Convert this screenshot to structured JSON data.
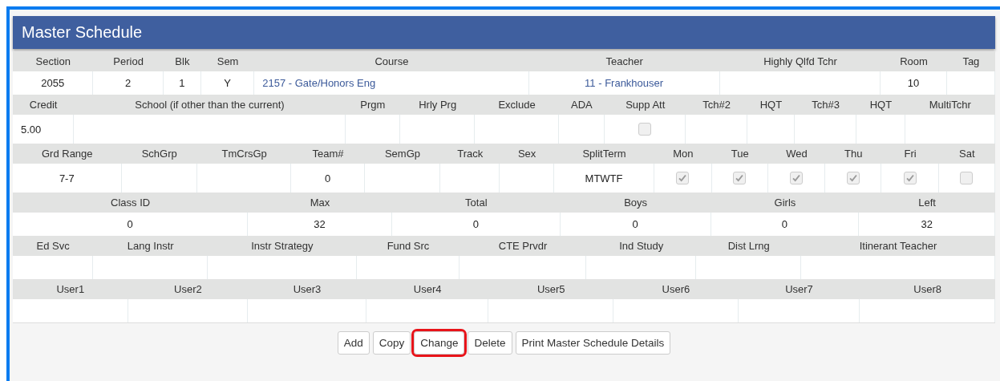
{
  "panel": {
    "title": "Master Schedule"
  },
  "sections": [
    {
      "columns": [
        {
          "label": "Section",
          "kind": "text",
          "value": "2055"
        },
        {
          "label": "Period",
          "kind": "text",
          "value": "2"
        },
        {
          "label": "Blk",
          "kind": "text",
          "value": "1"
        },
        {
          "label": "Sem",
          "kind": "text",
          "value": "Y"
        },
        {
          "label": "Course",
          "kind": "link",
          "value": "2157 - Gate/Honors Eng"
        },
        {
          "label": "Teacher",
          "kind": "link",
          "value": "11 - Frankhouser"
        },
        {
          "label": "Highly Qlfd Tchr",
          "kind": "empty"
        },
        {
          "label": "Room",
          "kind": "text",
          "value": "10"
        },
        {
          "label": "Tag",
          "kind": "empty"
        }
      ]
    },
    {
      "columns": [
        {
          "label": "Credit",
          "kind": "text",
          "value": "5.00"
        },
        {
          "label": "School (if other than the current)",
          "kind": "empty"
        },
        {
          "label": "Prgm",
          "kind": "empty"
        },
        {
          "label": "Hrly Prg",
          "kind": "empty"
        },
        {
          "label": "Exclude",
          "kind": "empty"
        },
        {
          "label": "ADA",
          "kind": "empty"
        },
        {
          "label": "Supp Att",
          "kind": "checkbox",
          "checked": false
        },
        {
          "label": "Tch#2",
          "kind": "empty"
        },
        {
          "label": "HQT",
          "kind": "empty"
        },
        {
          "label": "Tch#3",
          "kind": "empty"
        },
        {
          "label": "HQT",
          "kind": "empty"
        },
        {
          "label": "MultiTchr",
          "kind": "empty"
        }
      ]
    },
    {
      "columns": [
        {
          "label": "Grd Range",
          "kind": "text",
          "value": "7-7"
        },
        {
          "label": "SchGrp",
          "kind": "empty"
        },
        {
          "label": "TmCrsGp",
          "kind": "empty"
        },
        {
          "label": "Team#",
          "kind": "text",
          "value": "0"
        },
        {
          "label": "SemGp",
          "kind": "empty"
        },
        {
          "label": "Track",
          "kind": "empty"
        },
        {
          "label": "Sex",
          "kind": "empty"
        },
        {
          "label": "SplitTerm",
          "kind": "text",
          "value": "MTWTF"
        },
        {
          "label": "Mon",
          "kind": "checkbox",
          "checked": true
        },
        {
          "label": "Tue",
          "kind": "checkbox",
          "checked": true
        },
        {
          "label": "Wed",
          "kind": "checkbox",
          "checked": true
        },
        {
          "label": "Thu",
          "kind": "checkbox",
          "checked": true
        },
        {
          "label": "Fri",
          "kind": "checkbox",
          "checked": true
        },
        {
          "label": "Sat",
          "kind": "checkbox",
          "checked": false
        }
      ]
    },
    {
      "columns": [
        {
          "label": "Class ID",
          "kind": "text",
          "value": "0"
        },
        {
          "label": "Max",
          "kind": "text",
          "value": "32"
        },
        {
          "label": "Total",
          "kind": "text",
          "value": "0"
        },
        {
          "label": "Boys",
          "kind": "text",
          "value": "0"
        },
        {
          "label": "Girls",
          "kind": "text",
          "value": "0"
        },
        {
          "label": "Left",
          "kind": "text",
          "value": "32"
        }
      ]
    },
    {
      "columns": [
        {
          "label": "Ed Svc",
          "kind": "empty"
        },
        {
          "label": "Lang Instr",
          "kind": "empty"
        },
        {
          "label": "Instr Strategy",
          "kind": "empty"
        },
        {
          "label": "Fund Src",
          "kind": "empty"
        },
        {
          "label": "CTE Prvdr",
          "kind": "empty"
        },
        {
          "label": "Ind Study",
          "kind": "empty"
        },
        {
          "label": "Dist Lrng",
          "kind": "empty"
        },
        {
          "label": "Itinerant Teacher",
          "kind": "empty"
        }
      ]
    },
    {
      "columns": [
        {
          "label": "User1",
          "kind": "empty"
        },
        {
          "label": "User2",
          "kind": "empty"
        },
        {
          "label": "User3",
          "kind": "empty"
        },
        {
          "label": "User4",
          "kind": "empty"
        },
        {
          "label": "User5",
          "kind": "empty"
        },
        {
          "label": "User6",
          "kind": "empty"
        },
        {
          "label": "User7",
          "kind": "empty"
        },
        {
          "label": "User8",
          "kind": "empty"
        }
      ]
    }
  ],
  "buttons": [
    {
      "label": "Add",
      "highlighted": false
    },
    {
      "label": "Copy",
      "highlighted": false
    },
    {
      "label": "Change",
      "highlighted": true
    },
    {
      "label": "Delete",
      "highlighted": false
    },
    {
      "label": "Print Master Schedule Details",
      "highlighted": false
    }
  ]
}
